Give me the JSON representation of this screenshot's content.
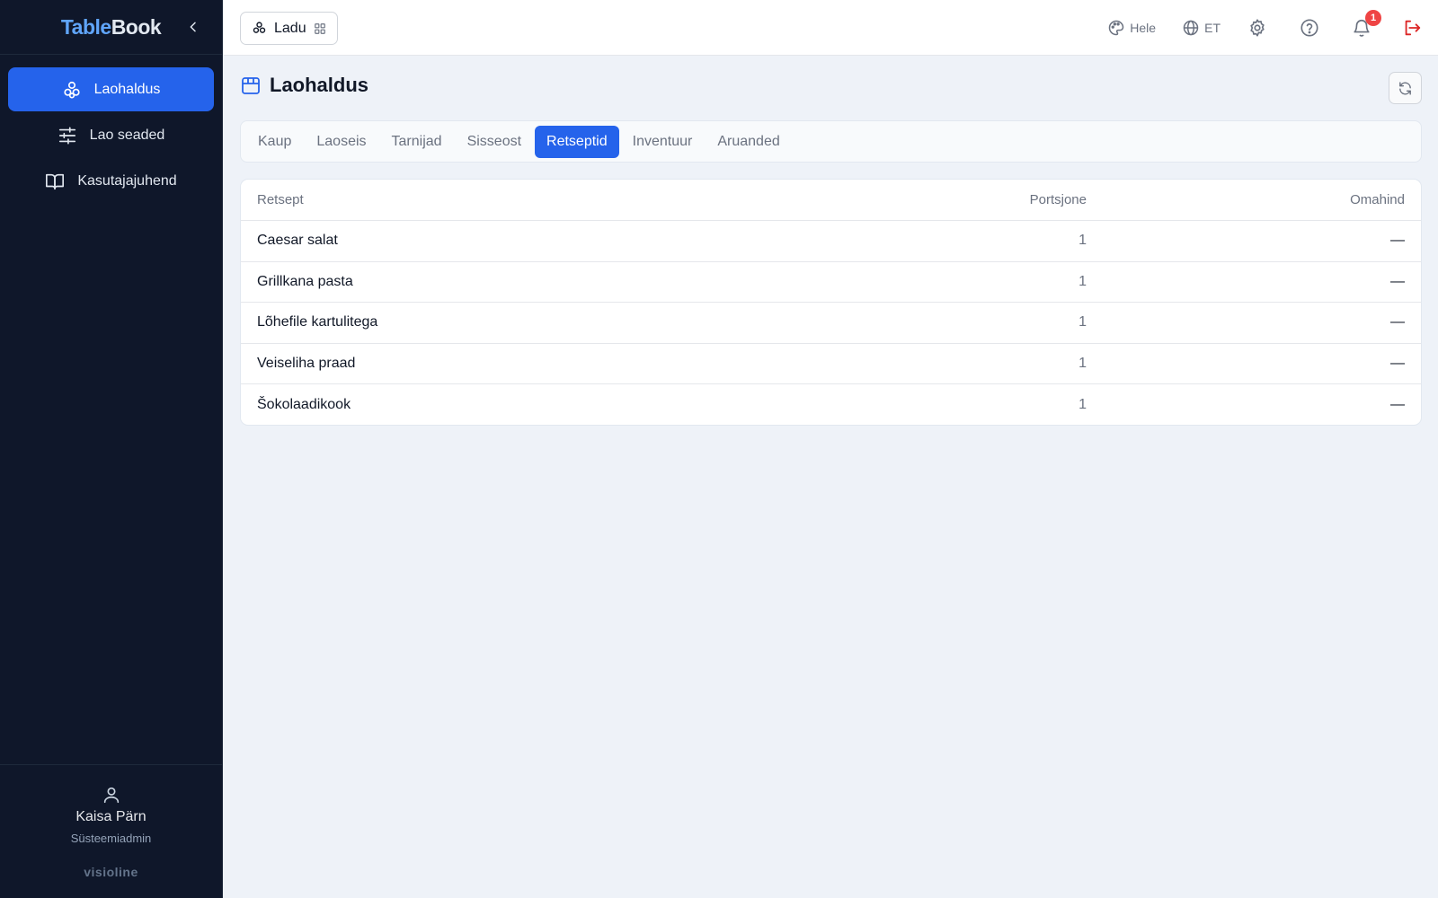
{
  "brand": {
    "part1": "Table",
    "part2": "Book"
  },
  "sidebar": {
    "items": [
      {
        "label": "Laohaldus",
        "icon": "boxes-icon",
        "active": true
      },
      {
        "label": "Lao seaded",
        "icon": "sliders-icon",
        "active": false
      },
      {
        "label": "Kasutajajuhend",
        "icon": "book-icon",
        "active": false
      }
    ],
    "user": {
      "name": "Kaisa Pärn",
      "role": "Süsteemiadmin"
    },
    "footer_brand": "visioline"
  },
  "topbar": {
    "module": "Ladu",
    "theme_label": "Hele",
    "language": "ET",
    "notifications_count": "1"
  },
  "page": {
    "title": "Laohaldus",
    "tabs": [
      {
        "label": "Kaup",
        "active": false
      },
      {
        "label": "Laoseis",
        "active": false
      },
      {
        "label": "Tarnijad",
        "active": false
      },
      {
        "label": "Sisseost",
        "active": false
      },
      {
        "label": "Retseptid",
        "active": true
      },
      {
        "label": "Inventuur",
        "active": false
      },
      {
        "label": "Aruanded",
        "active": false
      }
    ]
  },
  "table": {
    "headers": [
      "Retsept",
      "Portsjone",
      "Omahind"
    ],
    "rows": [
      [
        "Caesar salat",
        "1",
        "—"
      ],
      [
        "Grillkana pasta",
        "1",
        "—"
      ],
      [
        "Lõhefile kartulitega",
        "1",
        "—"
      ],
      [
        "Veiseliha praad",
        "1",
        "—"
      ],
      [
        "Šokolaadikook",
        "1",
        "—"
      ]
    ]
  },
  "colors": {
    "accent": "#2563eb",
    "sidebar_bg": "#0f172a",
    "danger": "#dc2626"
  }
}
